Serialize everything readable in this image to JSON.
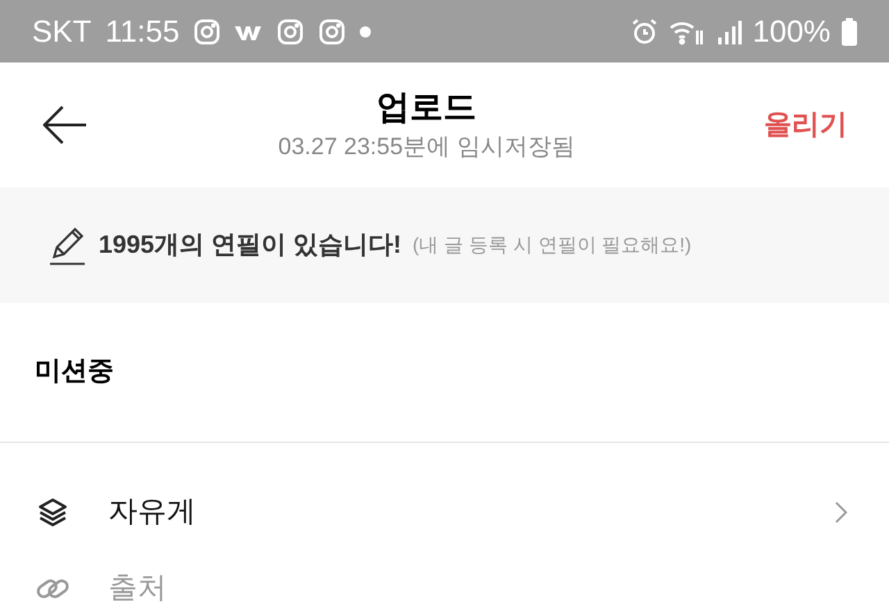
{
  "status_bar": {
    "carrier": "SKT",
    "time": "11:55",
    "battery": "100%"
  },
  "header": {
    "title": "업로드",
    "subtitle": "03.27 23:55분에 임시저장됨",
    "action": "올리기"
  },
  "banner": {
    "message": "1995개의 연필이 있습니다!",
    "hint": "(내 글 등록 시 연필이 필요해요!)"
  },
  "section": {
    "title": "미션중"
  },
  "options": [
    {
      "kind": "select",
      "label": "자유게"
    },
    {
      "kind": "link",
      "label": "출처"
    }
  ]
}
